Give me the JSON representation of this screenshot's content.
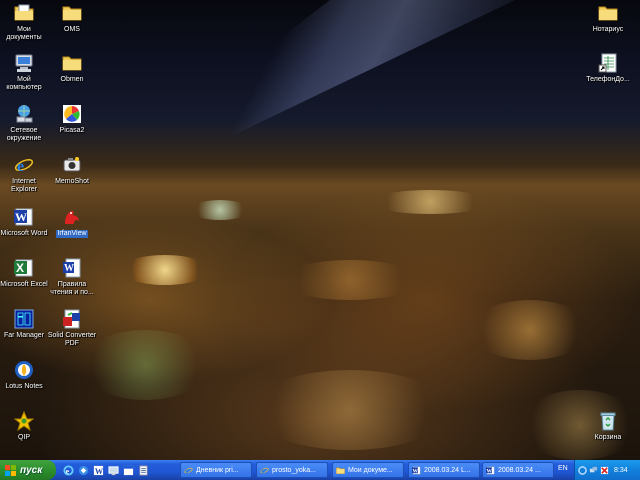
{
  "desktop": {
    "icons": [
      {
        "key": "my-documents",
        "label": "Мои\nдокументы",
        "icon": "folder-docs-icon"
      },
      {
        "key": "oms",
        "label": "OMS",
        "icon": "folder-icon"
      },
      {
        "key": "my-computer",
        "label": "Мой\nкомпьютер",
        "icon": "computer-icon"
      },
      {
        "key": "obmen",
        "label": "Obmen",
        "icon": "folder-icon"
      },
      {
        "key": "network",
        "label": "Сетевое\nокружение",
        "icon": "network-icon"
      },
      {
        "key": "picasa",
        "label": "Picasa2",
        "icon": "picasa-icon"
      },
      {
        "key": "ie",
        "label": "Internet\nExplorer",
        "icon": "ie-icon"
      },
      {
        "key": "memoshot",
        "label": "MemoShot",
        "icon": "camera-icon"
      },
      {
        "key": "word",
        "label": "Microsoft Word",
        "icon": "word-icon"
      },
      {
        "key": "irfanview",
        "label": "IrfanView",
        "icon": "irfanview-icon"
      },
      {
        "key": "excel",
        "label": "Microsoft Excel",
        "icon": "excel-icon"
      },
      {
        "key": "pravila",
        "label": "Правила\nчтения и по...",
        "icon": "word-doc-icon"
      },
      {
        "key": "far",
        "label": "Far Manager",
        "icon": "far-icon"
      },
      {
        "key": "solid",
        "label": "Solid Converter\nPDF",
        "icon": "solid-converter-icon"
      },
      {
        "key": "lotus",
        "label": "Lotus Notes",
        "icon": "lotus-icon"
      },
      {
        "key": "qip",
        "label": "QIP",
        "icon": "qip-icon"
      },
      {
        "key": "notarius",
        "label": "Нотариус",
        "icon": "folder-icon"
      },
      {
        "key": "telefon",
        "label": "ТелефонДо...",
        "icon": "excel-shortcut-icon"
      },
      {
        "key": "recycle",
        "label": "Корзина",
        "icon": "recycle-bin-icon"
      }
    ],
    "selected": "IrfanView"
  },
  "taskbar": {
    "start_label": "пуск",
    "quick_launch": [
      "ie-icon",
      "outlook-icon",
      "word-icon",
      "desktop-icon",
      "window-icon",
      "doc-icon"
    ],
    "tasks": [
      {
        "label": "Дневник pri...",
        "icon": "ie-icon"
      },
      {
        "label": "prosto_yoka...",
        "icon": "ie-icon"
      },
      {
        "label": "Мои докуме...",
        "icon": "folder-icon"
      },
      {
        "label": "2008.03.24 L...",
        "icon": "word-icon"
      },
      {
        "label": "2008.03.24 ...",
        "icon": "word-icon"
      }
    ],
    "language": "EN",
    "clock": "8:34",
    "tray_icons": [
      "ie-icon",
      "network-icon",
      "antivirus-icon"
    ]
  },
  "colors": {
    "taskbar": "#245edb",
    "start": "#2d8f2d",
    "tray": "#1280dc",
    "selection": "#316ac5"
  }
}
